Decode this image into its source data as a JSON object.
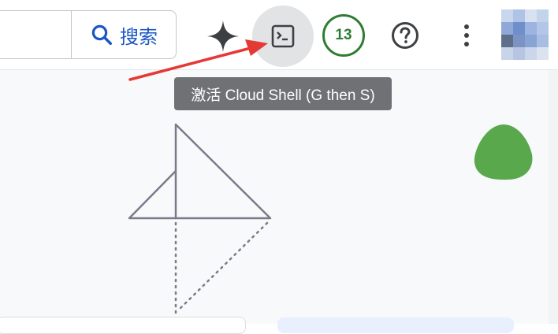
{
  "header": {
    "search_label": "搜索",
    "notification_count": "13",
    "icons": {
      "search": "search-icon",
      "gemini": "sparkle-icon",
      "cloud_shell": "terminal-icon",
      "help": "help-icon",
      "more": "more-vert-icon",
      "avatar": "avatar"
    }
  },
  "tooltip": {
    "text": "激活 Cloud Shell (G then S)"
  },
  "colors": {
    "accent_blue": "#1a56c4",
    "badge_green": "#2e7d32",
    "blob_green": "#5aa84c",
    "annotation_red": "#e53935",
    "tooltip_bg": "#6f7175"
  }
}
